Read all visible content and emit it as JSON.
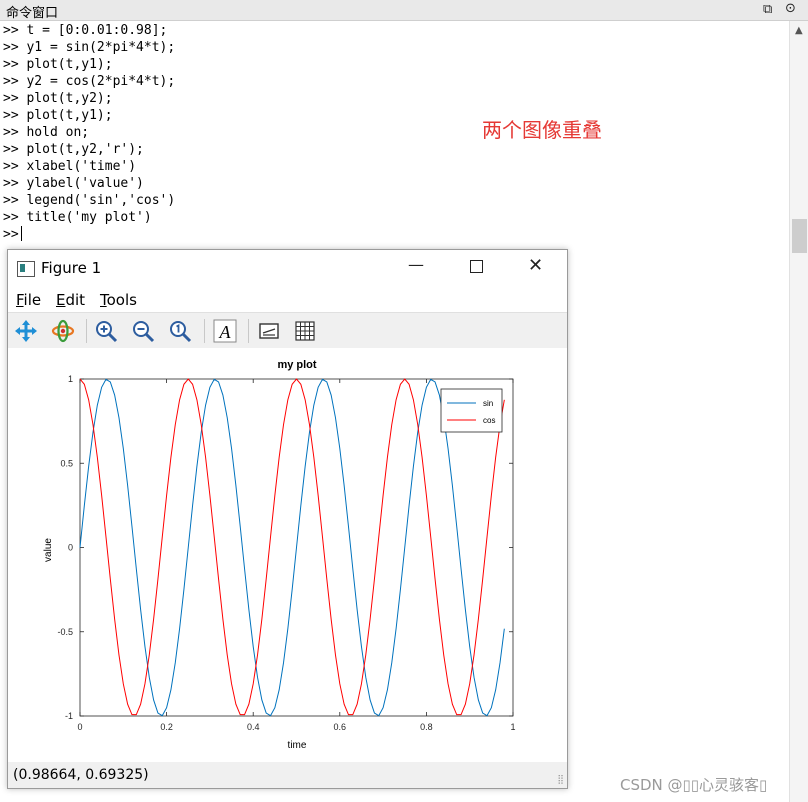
{
  "command_window": {
    "title": "命令窗口",
    "lines": [
      ">> t = [0:0.01:0.98];",
      ">> y1 = sin(2*pi*4*t);",
      ">> plot(t,y1);",
      ">> y2 = cos(2*pi*4*t);",
      ">> plot(t,y2);",
      ">> plot(t,y1);",
      ">> hold on;",
      ">> plot(t,y2,'r');",
      ">> xlabel('time')",
      ">> ylabel('value')",
      ">> legend('sin','cos')",
      ">> title('my plot')"
    ],
    "prompt": ">> "
  },
  "annotation": "两个图像重叠",
  "figure": {
    "title": "Figure 1",
    "menu": [
      {
        "key": "F",
        "rest": "ile"
      },
      {
        "key": "E",
        "rest": "dit"
      },
      {
        "key": "T",
        "rest": "ools"
      }
    ],
    "toolbar_icons": [
      "pan-icon",
      "rotate-icon",
      "zoom-in-icon",
      "zoom-out-icon",
      "zoom-reset-icon",
      "insert-text-icon",
      "legend-icon",
      "grid-icon"
    ],
    "status_coords": "(0.98664, 0.69325)"
  },
  "chart_data": {
    "type": "line",
    "title": "my plot",
    "xlabel": "time",
    "ylabel": "value",
    "xlim": [
      0,
      1
    ],
    "ylim": [
      -1,
      1
    ],
    "xticks": [
      "0",
      "0.2",
      "0.4",
      "0.6",
      "0.8",
      "1"
    ],
    "yticks": [
      "1",
      "0.5",
      "0",
      "-0.5",
      "-1"
    ],
    "x": {
      "start": 0,
      "step": 0.01,
      "end": 0.98
    },
    "series": [
      {
        "name": "sin",
        "expression": "sin(2*pi*4*t)",
        "color": "#0072BD"
      },
      {
        "name": "cos",
        "expression": "cos(2*pi*4*t)",
        "color": "#FF0000"
      }
    ],
    "legend_position": "top-right",
    "grid": false
  },
  "watermark": "CSDN @▯▯心灵骇客▯",
  "icons": {
    "undock": "undock-icon",
    "menu": "window-menu-icon",
    "scroll_up": "scroll-up-arrow"
  }
}
